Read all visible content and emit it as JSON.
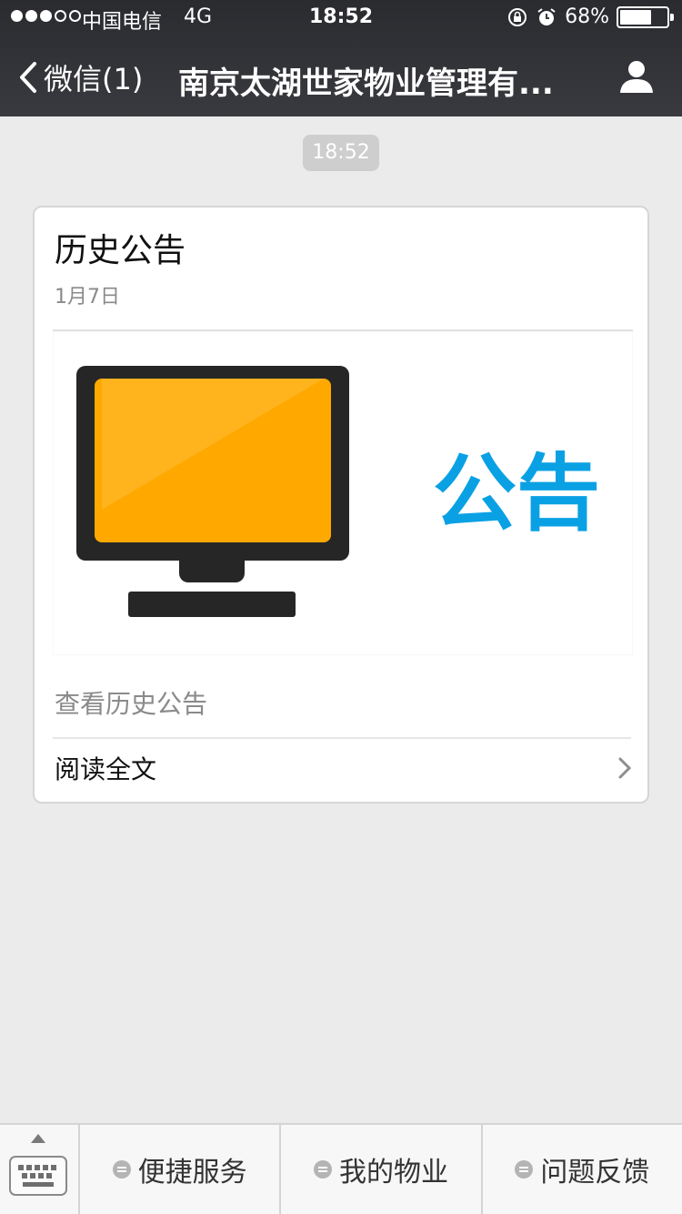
{
  "status_bar": {
    "carrier": "中国电信",
    "network": "4G",
    "time": "18:52",
    "battery": "68%",
    "battery_level": 0.68
  },
  "nav": {
    "back_label": "微信(1)",
    "title": "南京太湖世家物业管理有..."
  },
  "chat": {
    "timestamp": "18:52",
    "card": {
      "title": "历史公告",
      "date": "1月7日",
      "cover_text": "公告",
      "description": "查看历史公告",
      "read_label": "阅读全文"
    }
  },
  "menu": {
    "items": [
      {
        "label": "便捷服务"
      },
      {
        "label": "我的物业"
      },
      {
        "label": "问题反馈"
      }
    ]
  },
  "colors": {
    "nav_bg": "#393a3f",
    "page_bg": "#ebebeb",
    "monitor_screen": "#ffa800",
    "cover_text": "#0aa1e4"
  }
}
